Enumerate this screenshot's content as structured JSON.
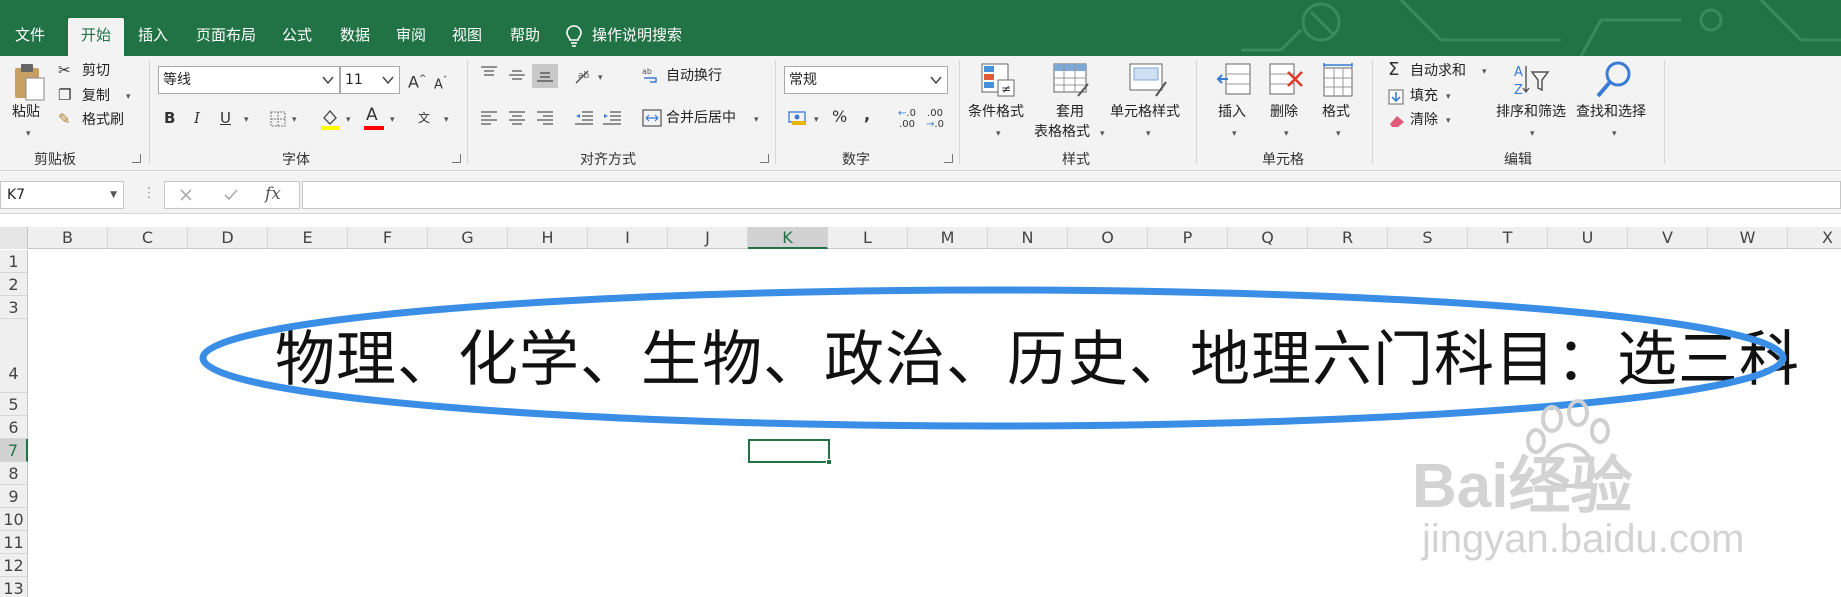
{
  "tabs": {
    "file": "文件",
    "home": "开始",
    "insert": "插入",
    "layout": "页面布局",
    "formulas": "公式",
    "data": "数据",
    "review": "审阅",
    "view": "视图",
    "help": "帮助",
    "search_hint": "操作说明搜索"
  },
  "clipboard": {
    "paste": "粘贴",
    "cut": "剪切",
    "copy": "复制",
    "format_painter": "格式刷",
    "group_label": "剪贴板"
  },
  "font": {
    "name": "等线",
    "size": "11",
    "bold": "B",
    "italic": "I",
    "underline": "U",
    "font_color_glyph": "A",
    "grow": "A",
    "shrink": "A",
    "group_label": "字体"
  },
  "alignment": {
    "wrap_text": "自动换行",
    "merge_center": "合并后居中",
    "group_label": "对齐方式"
  },
  "number": {
    "format": "常规",
    "percent": "%",
    "comma": ",",
    "inc_decimal": ".00",
    "dec_decimal": ".0",
    "group_label": "数字"
  },
  "styles": {
    "conditional": "条件格式",
    "table_format_1": "套用",
    "table_format_2": "表格格式",
    "cell_styles": "单元格样式",
    "group_label": "样式"
  },
  "cells": {
    "insert": "插入",
    "delete": "删除",
    "format": "格式",
    "group_label": "单元格"
  },
  "editing": {
    "autosum": "自动求和",
    "fill": "填充",
    "clear": "清除",
    "sort_filter": "排序和筛选",
    "find_select": "查找和选择",
    "group_label": "编辑"
  },
  "formula_bar": {
    "name_box": "K7",
    "fx": "fx",
    "content": ""
  },
  "columns": [
    "B",
    "C",
    "D",
    "E",
    "F",
    "G",
    "H",
    "I",
    "J",
    "K",
    "L",
    "M",
    "N",
    "O",
    "P",
    "Q",
    "R",
    "S",
    "T",
    "U",
    "V",
    "W",
    "X"
  ],
  "rows": [
    "1",
    "2",
    "3",
    "4",
    "5",
    "6",
    "7",
    "8",
    "9",
    "10",
    "11",
    "12",
    "13"
  ],
  "selected_cell": "K7",
  "cell_text": "物理、化学、生物、政治、历史、地理六门科目：选三科",
  "watermark": {
    "brand": "Bai经验",
    "url": "jingyan.baidu.com"
  },
  "colors": {
    "excel_green": "#217346",
    "ellipse_blue": "#3a8ee6",
    "ribbon_bg": "#f3f3f3"
  }
}
